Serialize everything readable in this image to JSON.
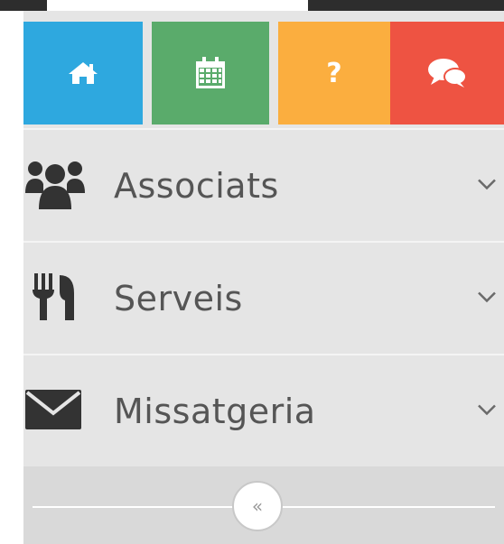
{
  "shortcuts": [
    {
      "name": "home",
      "icon": "home-icon",
      "color": "#2ea8df"
    },
    {
      "name": "calendar",
      "icon": "calendar-icon",
      "color": "#5aab6b"
    },
    {
      "name": "help",
      "icon": "question-icon",
      "color": "#fbae3f",
      "glyph": "?"
    },
    {
      "name": "chat",
      "icon": "chat-icon",
      "color": "#ee5342"
    }
  ],
  "menu": {
    "items": [
      {
        "label": "Associats",
        "icon": "users-icon"
      },
      {
        "label": "Serveis",
        "icon": "fork-knife-icon"
      },
      {
        "label": "Missatgeria",
        "icon": "envelope-icon"
      }
    ]
  },
  "collapse": {
    "glyph": "«",
    "icon": "double-chevron-left-icon"
  },
  "colors": {
    "sidebar_bg": "#e5e5e5",
    "text": "#555555",
    "icon_dark": "#333333"
  }
}
